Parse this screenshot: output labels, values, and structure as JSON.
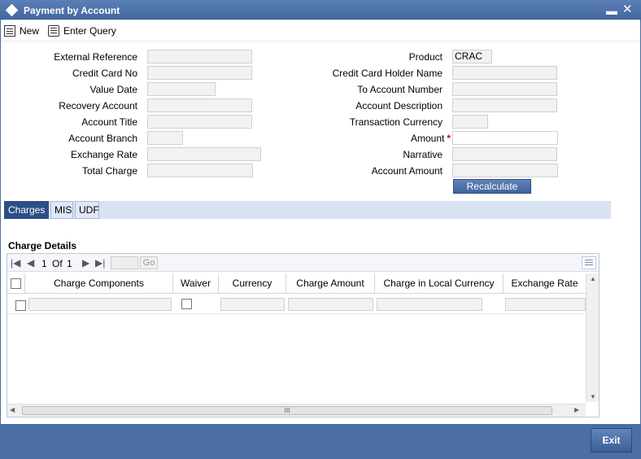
{
  "window": {
    "title": "Payment by Account",
    "minimize": "▬",
    "close": "✕"
  },
  "toolbar": {
    "new_label": "New",
    "enter_query_label": "Enter Query"
  },
  "form": {
    "left": [
      {
        "label": "External Reference",
        "value": ""
      },
      {
        "label": "Credit Card No",
        "value": ""
      },
      {
        "label": "Value Date",
        "value": ""
      },
      {
        "label": "Recovery Account",
        "value": ""
      },
      {
        "label": "Account Title",
        "value": ""
      },
      {
        "label": "Account Branch",
        "value": ""
      },
      {
        "label": "Exchange Rate",
        "value": ""
      },
      {
        "label": "Total Charge",
        "value": ""
      }
    ],
    "right": [
      {
        "label": "Product",
        "value": "CRAC"
      },
      {
        "label": "Credit Card Holder Name",
        "value": ""
      },
      {
        "label": "To Account Number",
        "value": ""
      },
      {
        "label": "Account Description",
        "value": ""
      },
      {
        "label": "Transaction Currency",
        "value": ""
      },
      {
        "label": "Amount",
        "value": "",
        "required_mark": "*"
      },
      {
        "label": "Narrative",
        "value": ""
      },
      {
        "label": "Account Amount",
        "value": ""
      }
    ],
    "recalculate_label": "Recalculate"
  },
  "tabs": [
    {
      "label": "Charges",
      "active": true
    },
    {
      "label": "MIS",
      "active": false
    },
    {
      "label": "UDF",
      "active": false
    }
  ],
  "charge_details": {
    "title": "Charge Details",
    "pager": {
      "current": "1",
      "of_label": "Of",
      "total": "1",
      "go_label": "Go"
    },
    "columns": [
      "Charge Components",
      "Waiver",
      "Currency",
      "Charge Amount",
      "Charge in Local Currency",
      "Exchange Rate"
    ],
    "rows": [
      {
        "charge_component": "",
        "waiver": false,
        "currency": "",
        "charge_amount": "",
        "charge_local": "",
        "exchange_rate": ""
      }
    ],
    "hscroll_grip": "III"
  },
  "footer": {
    "exit_label": "Exit"
  }
}
